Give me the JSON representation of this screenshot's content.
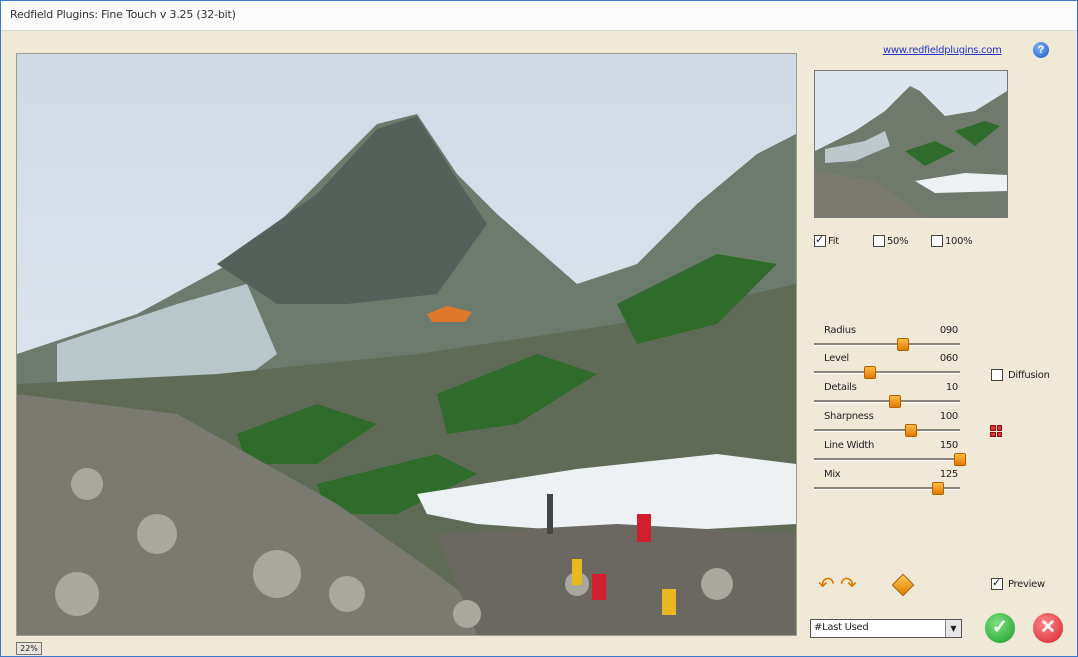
{
  "window": {
    "title": "Redfield Plugins: Fine Touch v 3.25 (32-bit)"
  },
  "header": {
    "website_link": "www.redfieldplugins.com",
    "help_icon": "help-icon"
  },
  "preview": {
    "zoom_label": "22%",
    "image_subject": "mountain-painting"
  },
  "zoom_options": [
    {
      "label": "Fit",
      "checked": true
    },
    {
      "label": "50%",
      "checked": false
    },
    {
      "label": "100%",
      "checked": false
    }
  ],
  "sliders": [
    {
      "label": "Radius",
      "value": "090",
      "fraction": 0.6
    },
    {
      "label": "Level",
      "value": "060",
      "fraction": 0.38
    },
    {
      "label": "Details",
      "value": "10",
      "fraction": 0.55
    },
    {
      "label": "Sharpness",
      "value": "100",
      "fraction": 0.66
    },
    {
      "label": "Line Width",
      "value": "150",
      "fraction": 0.99
    },
    {
      "label": "Mix",
      "value": "125",
      "fraction": 0.84
    }
  ],
  "options": {
    "diffusion_label": "Diffusion",
    "diffusion_checked": false,
    "preview_label": "Preview",
    "preview_checked": true
  },
  "preset": {
    "selected": "#Last Used"
  },
  "actions": {
    "ok_icon": "checkmark-icon",
    "cancel_icon": "close-icon"
  },
  "colors": {
    "accent": "#e07a00",
    "link": "#2233cc",
    "ok": "#1b9a2a",
    "cancel": "#d21f2f"
  }
}
